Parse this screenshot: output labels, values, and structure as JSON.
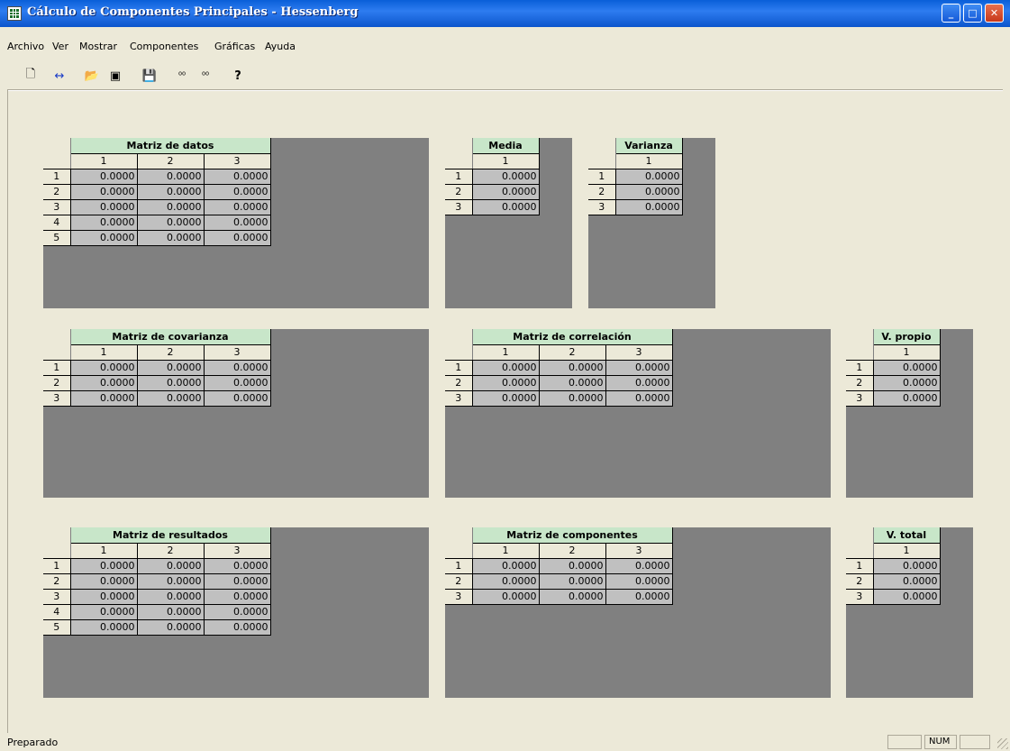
{
  "window": {
    "title": "Cálculo de Componentes Principales - Hessenberg"
  },
  "menu": [
    "Archivo",
    "Ver",
    "Mostrar",
    "Componentes",
    "Gráficas",
    "Ayuda"
  ],
  "status": {
    "text": "Preparado",
    "num": "NUM"
  },
  "panels": {
    "datos": {
      "title": "Matriz de datos",
      "cols": [
        "1",
        "2",
        "3"
      ],
      "rows": [
        "1",
        "2",
        "3",
        "4",
        "5"
      ],
      "value": "0.0000"
    },
    "media": {
      "title": "Media",
      "cols": [
        "1"
      ],
      "rows": [
        "1",
        "2",
        "3"
      ],
      "value": "0.0000"
    },
    "varianza": {
      "title": "Varianza",
      "cols": [
        "1"
      ],
      "rows": [
        "1",
        "2",
        "3"
      ],
      "value": "0.0000"
    },
    "covarianza": {
      "title": "Matriz de covarianza",
      "cols": [
        "1",
        "2",
        "3"
      ],
      "rows": [
        "1",
        "2",
        "3"
      ],
      "value": "0.0000"
    },
    "correlacion": {
      "title": "Matriz de correlación",
      "cols": [
        "1",
        "2",
        "3"
      ],
      "rows": [
        "1",
        "2",
        "3"
      ],
      "value": "0.0000"
    },
    "vpropio": {
      "title": "V. propio",
      "cols": [
        "1"
      ],
      "rows": [
        "1",
        "2",
        "3"
      ],
      "value": "0.0000"
    },
    "resultados": {
      "title": "Matriz de resultados",
      "cols": [
        "1",
        "2",
        "3"
      ],
      "rows": [
        "1",
        "2",
        "3",
        "4",
        "5"
      ],
      "value": "0.0000"
    },
    "componentes": {
      "title": "Matriz de componentes",
      "cols": [
        "1",
        "2",
        "3"
      ],
      "rows": [
        "1",
        "2",
        "3"
      ],
      "value": "0.0000"
    },
    "vtotal": {
      "title": "V. total",
      "cols": [
        "1"
      ],
      "rows": [
        "1",
        "2",
        "3"
      ],
      "value": "0.0000"
    }
  },
  "toolbar": {
    "icons": [
      "new-document-icon",
      "resize-icon",
      "open-folder-icon",
      "window-icon",
      "save-icon",
      "data-import-icon",
      "data-export-icon",
      "help-icon"
    ],
    "glyphs": [
      "🗋",
      "↔",
      "📂",
      "▣",
      "💾",
      "⁰⁰",
      "⁰⁰",
      "?"
    ]
  },
  "colors": {
    "title_cell": "#c8e6c9",
    "panel_bg": "#808080",
    "cell_bg": "#c0c0c0"
  }
}
